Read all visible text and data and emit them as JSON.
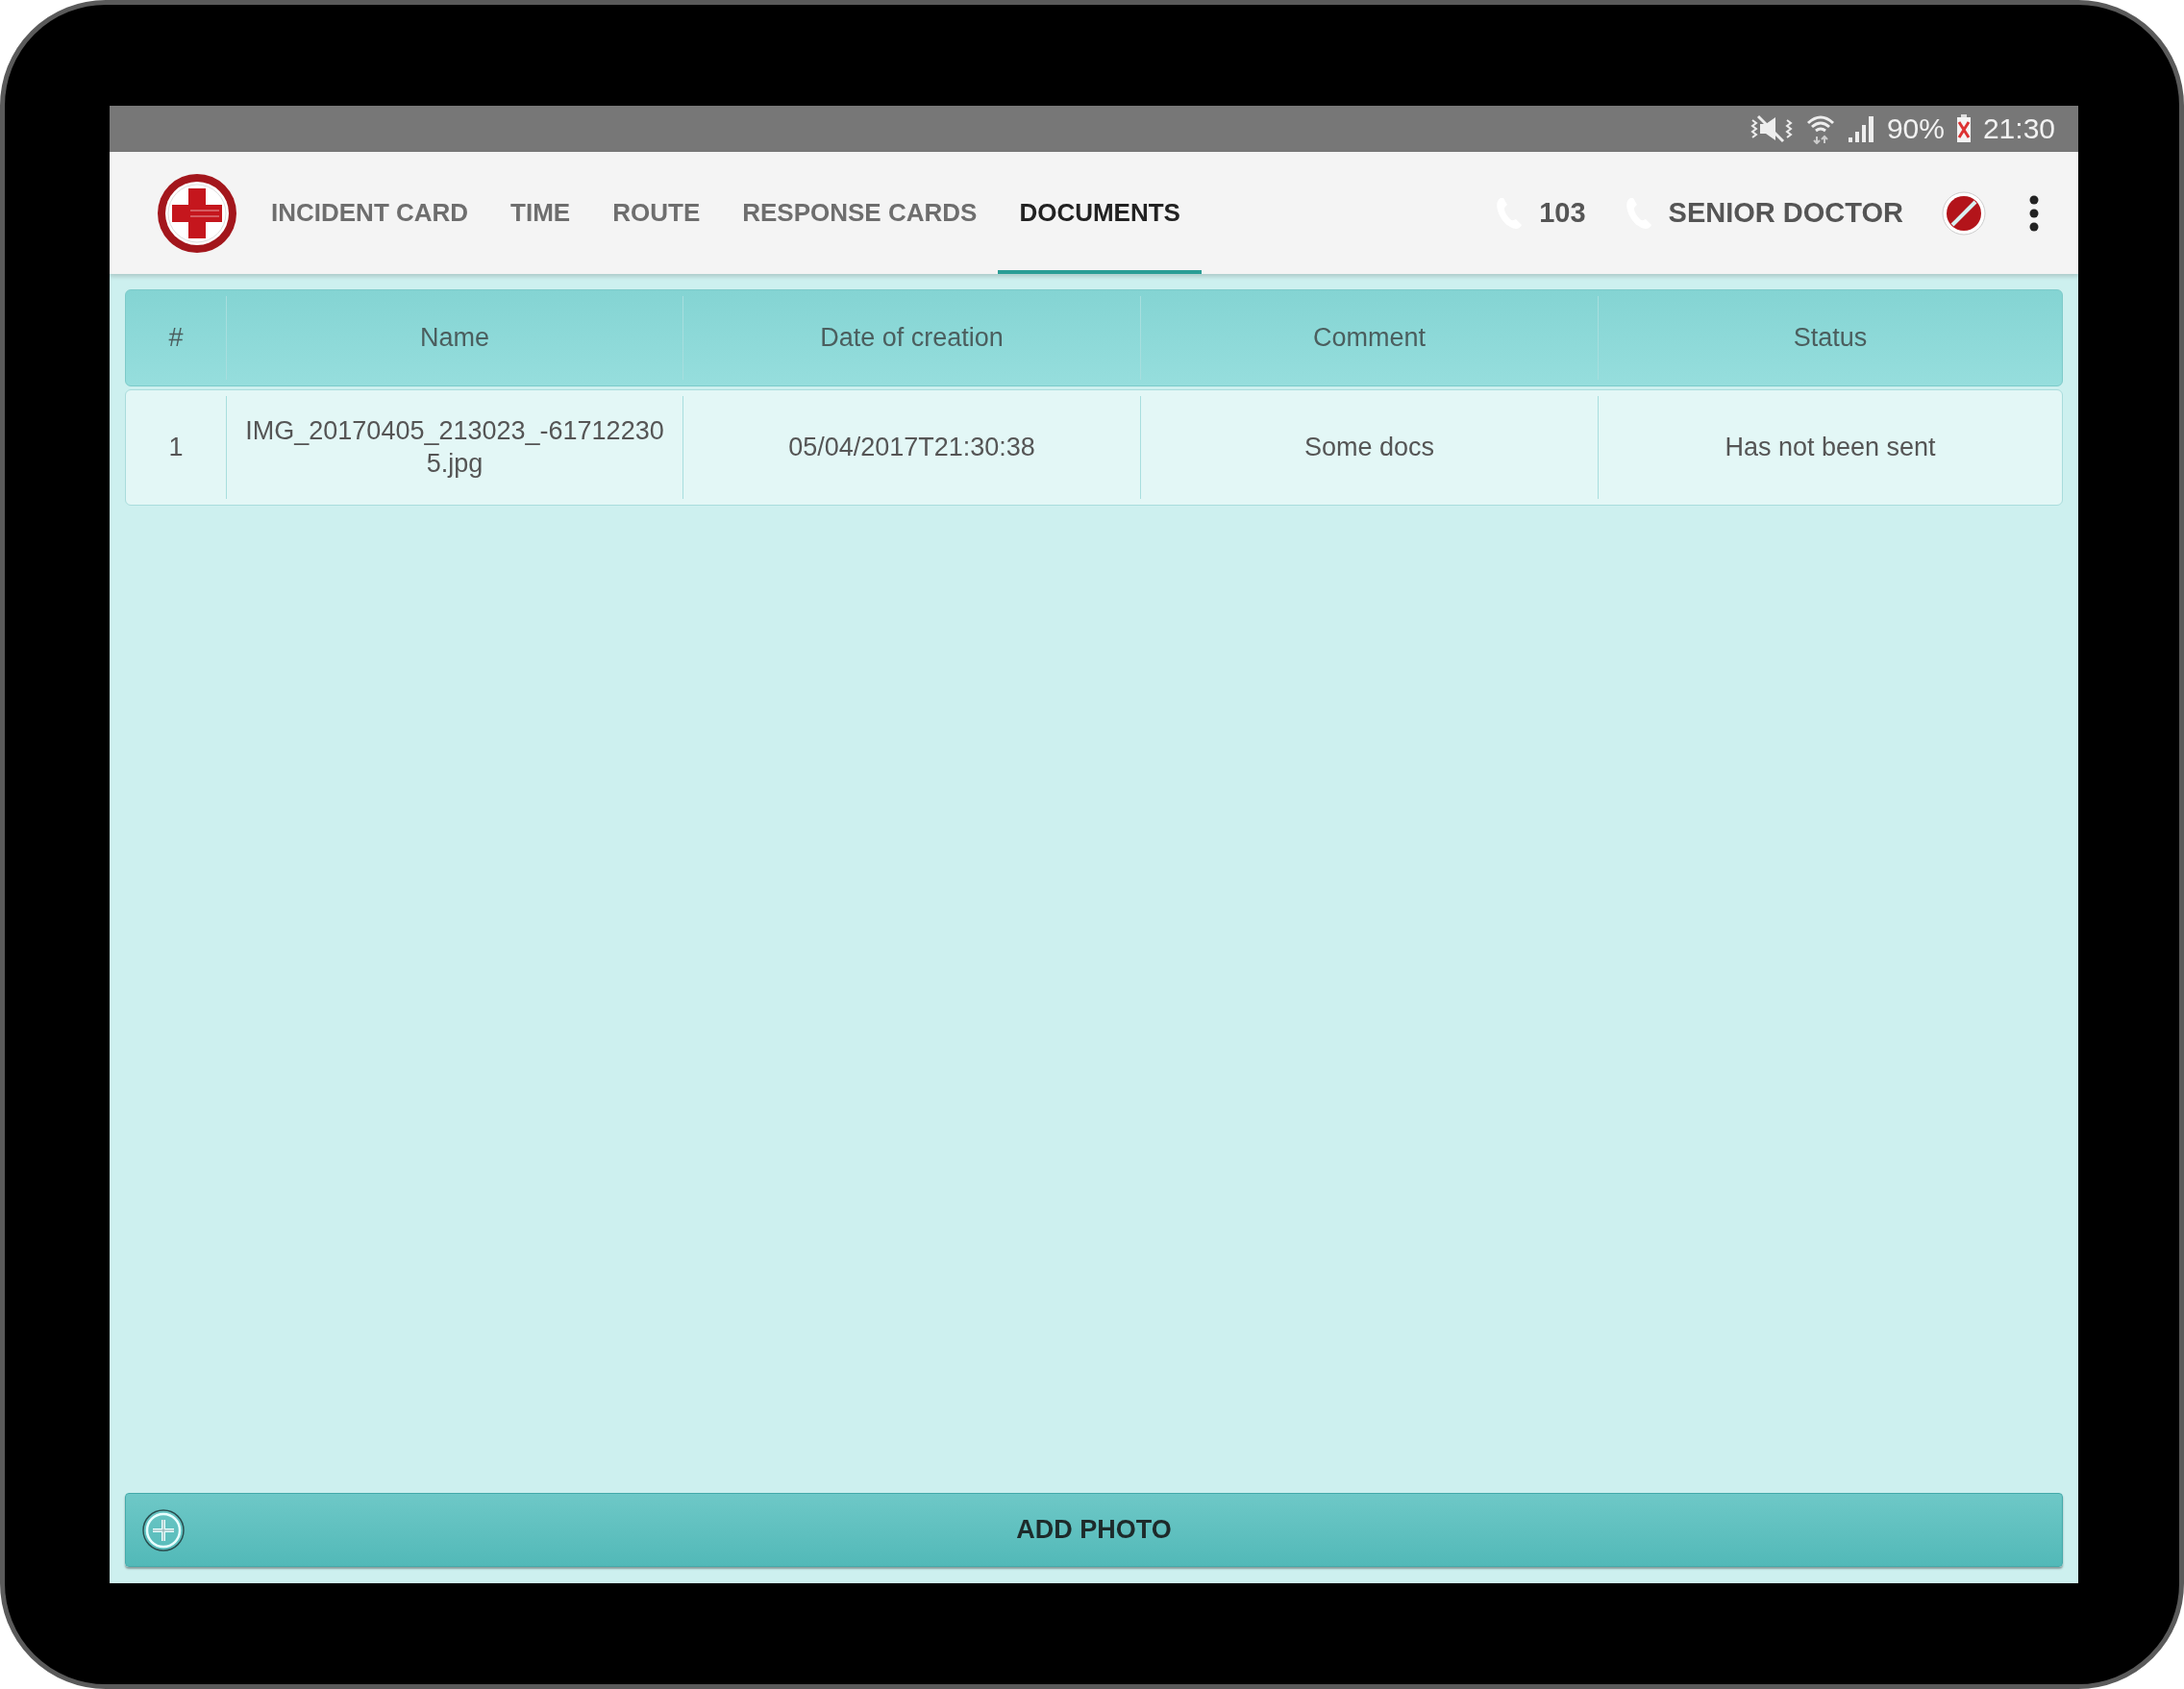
{
  "status_bar": {
    "battery": "90%",
    "time": "21:30"
  },
  "tabs": [
    {
      "label": "INCIDENT CARD",
      "selected": false
    },
    {
      "label": "TIME",
      "selected": false
    },
    {
      "label": "ROUTE",
      "selected": false
    },
    {
      "label": "RESPONSE CARDS",
      "selected": false
    },
    {
      "label": "DOCUMENTS",
      "selected": true
    }
  ],
  "phone": "103",
  "role": "SENIOR DOCTOR",
  "table": {
    "columns": [
      "#",
      "Name",
      "Date of creation",
      "Comment",
      "Status"
    ],
    "rows": [
      [
        "1",
        "IMG_20170405_213023_-617122305.jpg",
        "05/04/2017T21:30:38",
        "Some docs",
        "Has not been sent"
      ]
    ]
  },
  "add_button": "ADD PHOTO"
}
